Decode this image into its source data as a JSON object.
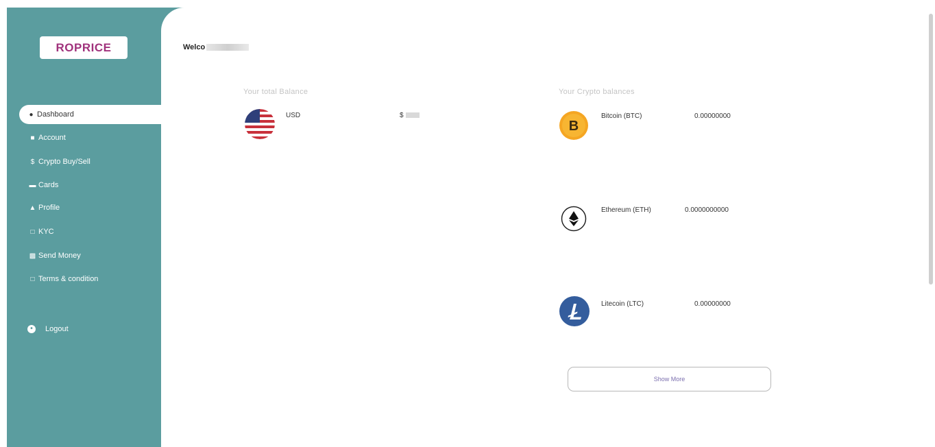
{
  "brand": {
    "logo_text": "ROPRICE",
    "logo_color": "#a0327c",
    "sidebar_color": "#5b9d9f"
  },
  "sidebar": {
    "items": [
      {
        "label": "Dashboard",
        "icon": "dashboard-icon",
        "active": true
      },
      {
        "label": "Account",
        "icon": "bank-icon",
        "active": false
      },
      {
        "label": "Crypto Buy/Sell",
        "icon": "dollar-icon",
        "active": false
      },
      {
        "label": "Cards",
        "icon": "card-icon",
        "active": false
      },
      {
        "label": "Profile",
        "icon": "user-icon",
        "active": false
      },
      {
        "label": "KYC",
        "icon": "document-icon",
        "active": false
      },
      {
        "label": "Send Money",
        "icon": "money-icon",
        "active": false
      },
      {
        "label": "Terms & condition",
        "icon": "document-icon",
        "active": false
      }
    ],
    "logout_label": "Logout"
  },
  "header": {
    "welcome_text": "Welco"
  },
  "balance": {
    "title": "Your total Balance",
    "currency": "USD",
    "amount_prefix": "$"
  },
  "crypto": {
    "title": "Your Crypto balances",
    "coins": [
      {
        "name": "Bitcoin (BTC)",
        "value": "0.00000000",
        "icon": "bitcoin-icon",
        "color": "#f5a623"
      },
      {
        "name": "Ethereum (ETH)",
        "value": "0.0000000000",
        "icon": "ethereum-icon",
        "color": "#ffffff"
      },
      {
        "name": "Litecoin (LTC)",
        "value": "0.00000000",
        "icon": "litecoin-icon",
        "color": "#345d9d"
      }
    ],
    "show_more_label": "Show More"
  }
}
